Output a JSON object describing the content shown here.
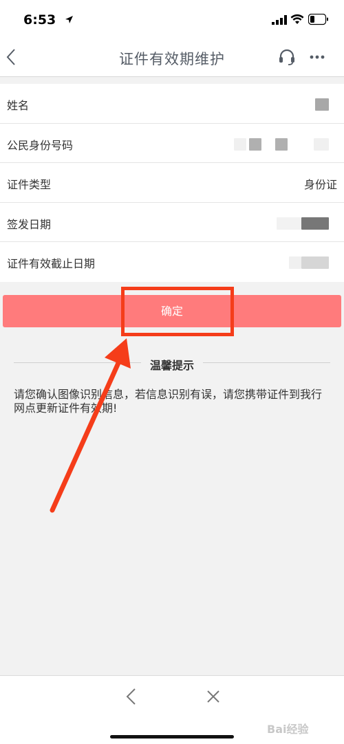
{
  "status_bar": {
    "time": "6:53"
  },
  "nav": {
    "title": "证件有效期维护"
  },
  "form": {
    "rows": [
      {
        "label": "姓名",
        "value": ""
      },
      {
        "label": "公民身份号码",
        "value": ""
      },
      {
        "label": "证件类型",
        "value": "身份证"
      },
      {
        "label": "签发日期",
        "value": ""
      },
      {
        "label": "证件有效截止日期",
        "value": ""
      }
    ]
  },
  "confirm_label": "确定",
  "tips": {
    "title": "温馨提示",
    "text": "请您确认图像识别信息，若信息识别有误，请您携带证件到我行网点更新证件有效期!"
  },
  "watermark": "Bai经验",
  "colors": {
    "accent_button": "#ff7b7c",
    "annotation": "#f53d1a",
    "title_text": "#555c66"
  }
}
